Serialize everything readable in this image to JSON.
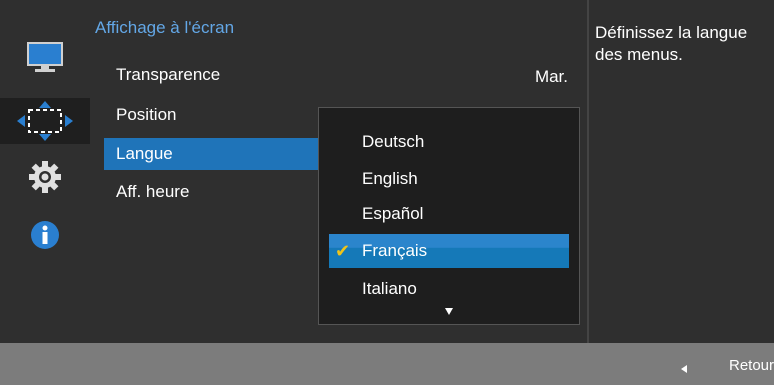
{
  "colors": {
    "panel_bg": "#2f2f2f",
    "title_color": "#63a7e6",
    "selection_blue": "#1f74b9",
    "checkmark": "#f0c419",
    "bottom_bar": "#7c7c7c"
  },
  "sidebar": {
    "items": [
      {
        "icon": "monitor-icon",
        "active": false
      },
      {
        "icon": "move-arrows-icon",
        "active": true
      },
      {
        "icon": "gear-icon",
        "active": false
      },
      {
        "icon": "info-icon",
        "active": false
      }
    ]
  },
  "menu": {
    "title": "Affichage à l'écran",
    "items": [
      {
        "label": "Transparence",
        "value": "Mar."
      },
      {
        "label": "Position"
      },
      {
        "label": "Langue",
        "selected": true
      },
      {
        "label": "Aff. heure"
      }
    ]
  },
  "submenu": {
    "options": [
      {
        "label": "Deutsch"
      },
      {
        "label": "English"
      },
      {
        "label": "Español"
      },
      {
        "label": "Français",
        "selected": true
      },
      {
        "label": "Italiano"
      }
    ],
    "scroll_indicator": "arrow-down-icon"
  },
  "help": {
    "text": "Définissez la langue des menus."
  },
  "bottom_bar": {
    "back_label": "Retour",
    "back_icon": "left-arrow-icon"
  }
}
